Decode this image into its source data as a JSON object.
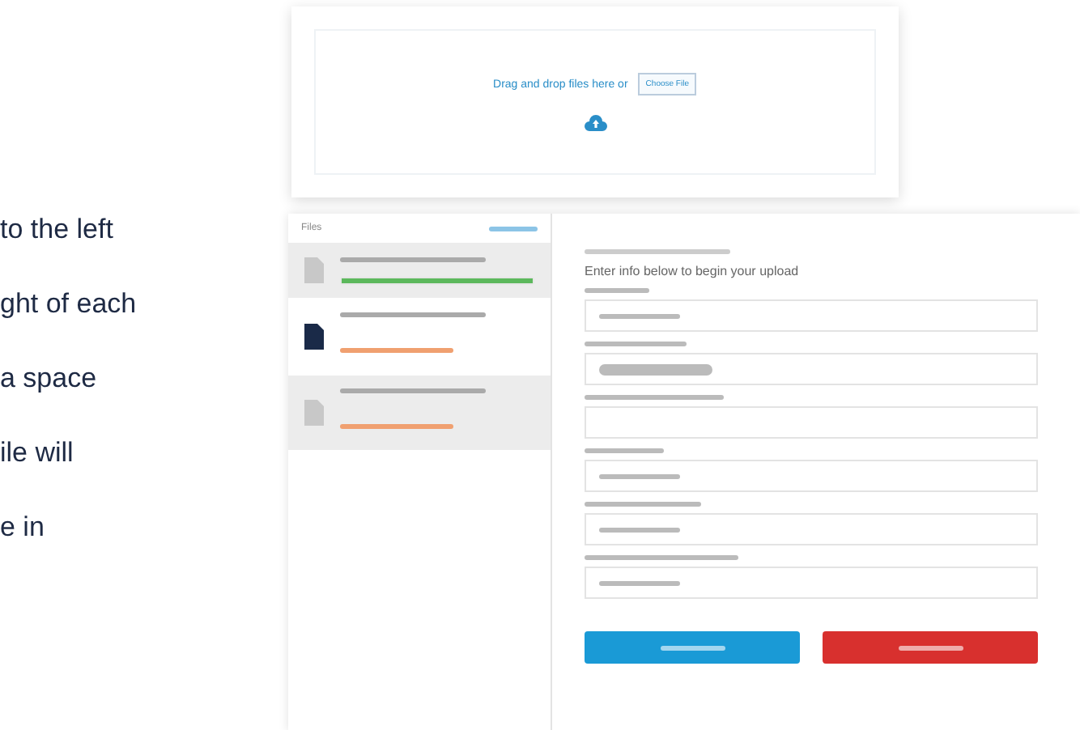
{
  "dropzone": {
    "prompt": "Drag and drop files here or",
    "button": "Choose File"
  },
  "instructions": [
    "to the left",
    "ght of each",
    "a space",
    "ile will",
    "e in"
  ],
  "files_panel": {
    "title": "Files",
    "items": [
      {
        "selected": false,
        "kind": "progress",
        "level": 1
      },
      {
        "selected": true,
        "kind": "error"
      },
      {
        "selected": false,
        "kind": "error"
      }
    ]
  },
  "form": {
    "heading": "Enter info below to begin your upload",
    "fields": [
      {
        "kind": "text"
      },
      {
        "kind": "chip"
      },
      {
        "kind": "empty"
      },
      {
        "kind": "text"
      },
      {
        "kind": "text"
      },
      {
        "kind": "text"
      }
    ],
    "buttons": [
      {
        "kind": "primary"
      },
      {
        "kind": "danger"
      }
    ]
  }
}
